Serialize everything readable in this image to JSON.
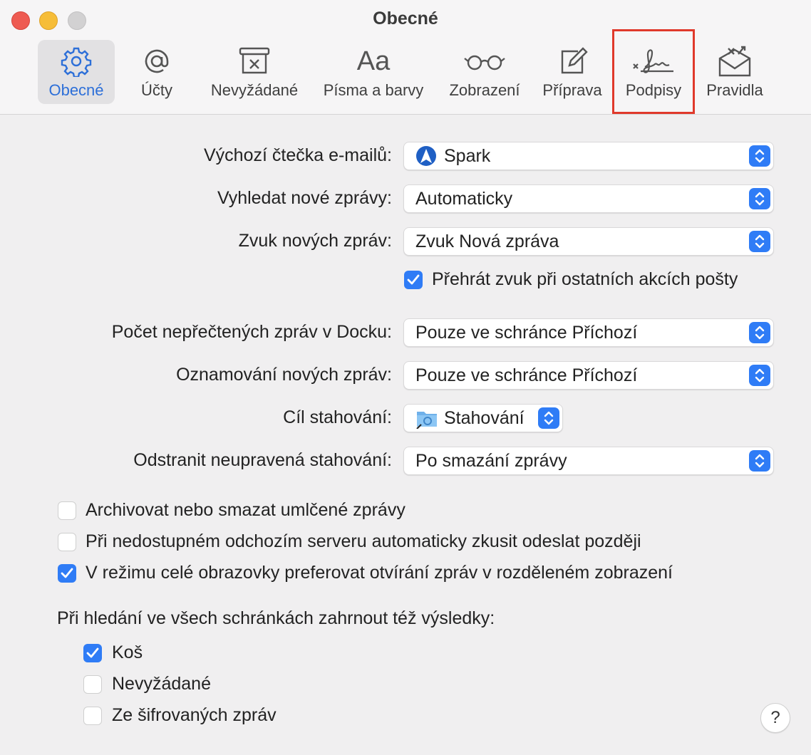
{
  "window": {
    "title": "Obecné"
  },
  "toolbar": {
    "tabs": [
      {
        "label": "Obecné",
        "icon": "gear-icon"
      },
      {
        "label": "Účty",
        "icon": "at-sign-icon"
      },
      {
        "label": "Nevyžádané",
        "icon": "junk-tray-icon"
      },
      {
        "label": "Písma a barvy",
        "icon": "font-icon",
        "glyph": "Aa"
      },
      {
        "label": "Zobrazení",
        "icon": "glasses-icon"
      },
      {
        "label": "Příprava",
        "icon": "compose-icon"
      },
      {
        "label": "Podpisy",
        "icon": "signature-icon"
      },
      {
        "label": "Pravidla",
        "icon": "rules-envelope-icon"
      }
    ],
    "active_tab": "Obecné",
    "highlighted_tab": "Podpisy"
  },
  "settings": {
    "default_reader": {
      "label": "Výchozí čtečka e-mailů:",
      "value": "Spark"
    },
    "check_new": {
      "label": "Vyhledat nové zprávy:",
      "value": "Automaticky"
    },
    "new_sound": {
      "label": "Zvuk nových zpráv:",
      "value": "Zvuk Nová zpráva"
    },
    "play_sounds": {
      "label": "Přehrát zvuk při ostatních akcích pošty",
      "checked": true
    },
    "dock_unread": {
      "label": "Počet nepřečtených zpráv v Docku:",
      "value": "Pouze ve schránce Příchozí"
    },
    "notifications": {
      "label": "Oznamování nových zpráv:",
      "value": "Pouze ve schránce Příchozí"
    },
    "download_folder": {
      "label": "Cíl stahování:",
      "value": "Stahování"
    },
    "remove_downloads": {
      "label": "Odstranit neupravená stahování:",
      "value": "Po smazání zprávy"
    }
  },
  "options": [
    {
      "label": "Archivovat nebo smazat umlčené zprávy",
      "checked": false
    },
    {
      "label": "Při nedostupném odchozím serveru automaticky zkusit odeslat později",
      "checked": false
    },
    {
      "label": "V režimu celé obrazovky preferovat otvírání zpráv v rozděleném zobrazení",
      "checked": true
    }
  ],
  "search": {
    "heading": "Při hledání ve všech schránkách zahrnout též výsledky:",
    "items": [
      {
        "label": "Koš",
        "checked": true
      },
      {
        "label": "Nevyžádané",
        "checked": false
      },
      {
        "label": "Ze šifrovaných zpráv",
        "checked": false
      }
    ]
  },
  "help": {
    "label": "?"
  },
  "colors": {
    "accent": "#2f7cf6",
    "highlight_box": "#e0392b",
    "active_tab_text": "#2d6fd8"
  }
}
